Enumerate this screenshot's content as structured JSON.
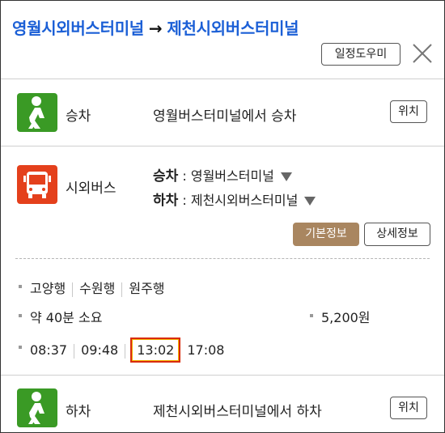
{
  "header": {
    "from": "영월시외버스터미널",
    "arrow": "→",
    "to": "제천시외버스터미널",
    "schedule_button": "일정도우미"
  },
  "steps": {
    "board": {
      "mode": "승차",
      "description": "영월버스터미널에서 승차",
      "location_button": "위치"
    },
    "bus": {
      "mode": "시외버스",
      "board_label": "승차",
      "board_stop": "영월버스터미널",
      "alight_label": "하차",
      "alight_stop": "제천시외버스터미널",
      "basic_button": "기본정보",
      "detail_button": "상세정보",
      "directions": [
        "고양행",
        "수원행",
        "원주행"
      ],
      "duration": "약 40분 소요",
      "fare": "5,200원",
      "times": [
        "08:37",
        "09:48",
        "13:02",
        "17:08"
      ],
      "highlighted_time": "13:02"
    },
    "alight": {
      "mode": "하차",
      "description": "제천시외버스터미널에서 하차",
      "location_button": "위치"
    }
  },
  "colors": {
    "route_blue": "#1b5fd6",
    "walk_green": "#3a9a25",
    "bus_red": "#e4401c",
    "basic_button": "#a98660",
    "highlight": "#d92b0b"
  }
}
